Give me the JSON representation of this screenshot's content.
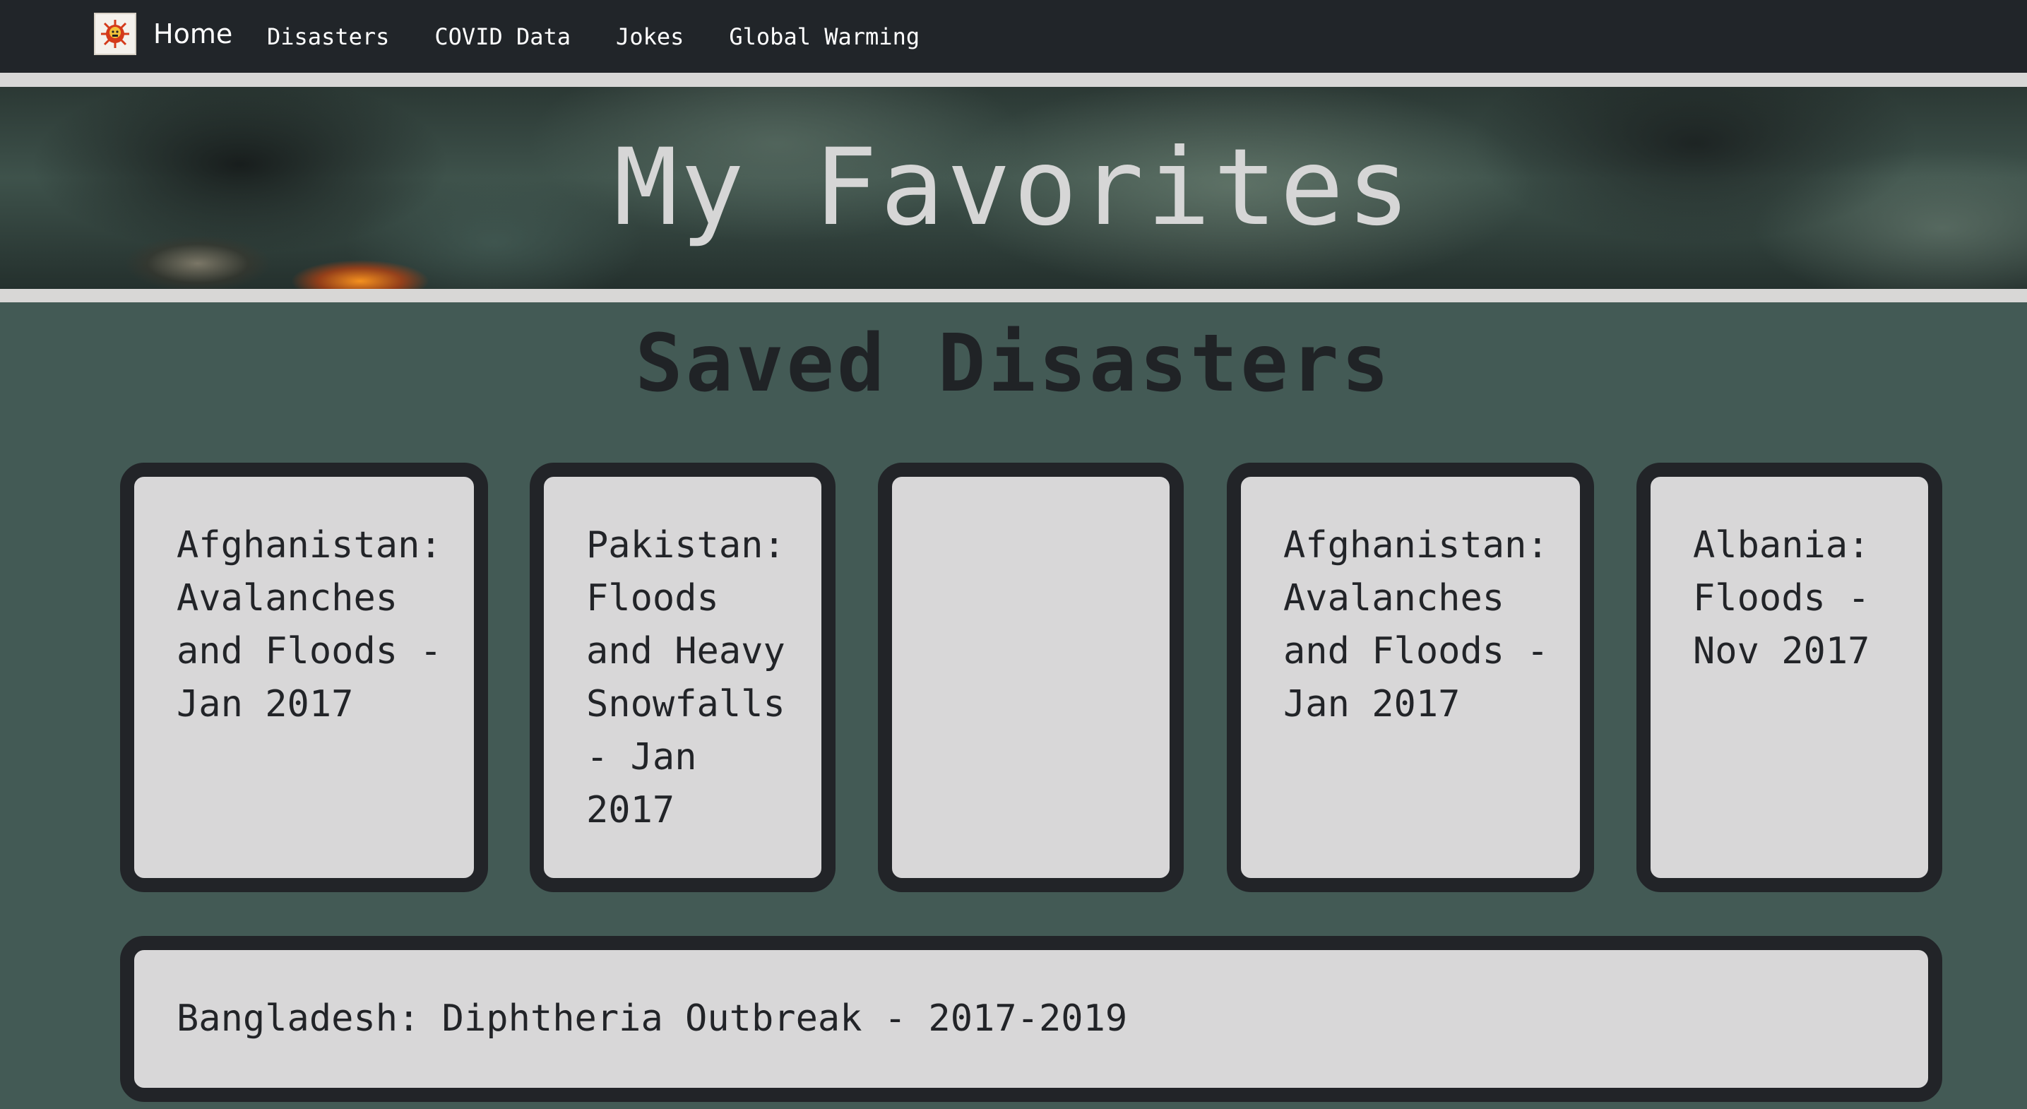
{
  "navbar": {
    "brand_label": "Home",
    "logo_icon": "virus-logo-icon",
    "links": [
      "Disasters",
      "COVID Data",
      "Jokes",
      "Global Warming"
    ]
  },
  "banner": {
    "title": "My Favorites"
  },
  "section": {
    "title": "Saved Disasters"
  },
  "cards": [
    {
      "label": "Afghanistan: Avalanches and Floods - Jan 2017"
    },
    {
      "label": "Pakistan: Floods and Heavy Snowfalls - Jan 2017"
    },
    {
      "label": ""
    },
    {
      "label": "Afghanistan: Avalanches and Floods - Jan 2017"
    },
    {
      "label": "Albania: Floods - Nov 2017"
    },
    {
      "label": "Bangladesh: Diphtheria Outbreak - 2017-2019"
    }
  ],
  "colors": {
    "navbar_bg": "#212529",
    "page_bg": "#435a55",
    "card_bg": "#d8d7d8",
    "card_border": "#222428"
  }
}
